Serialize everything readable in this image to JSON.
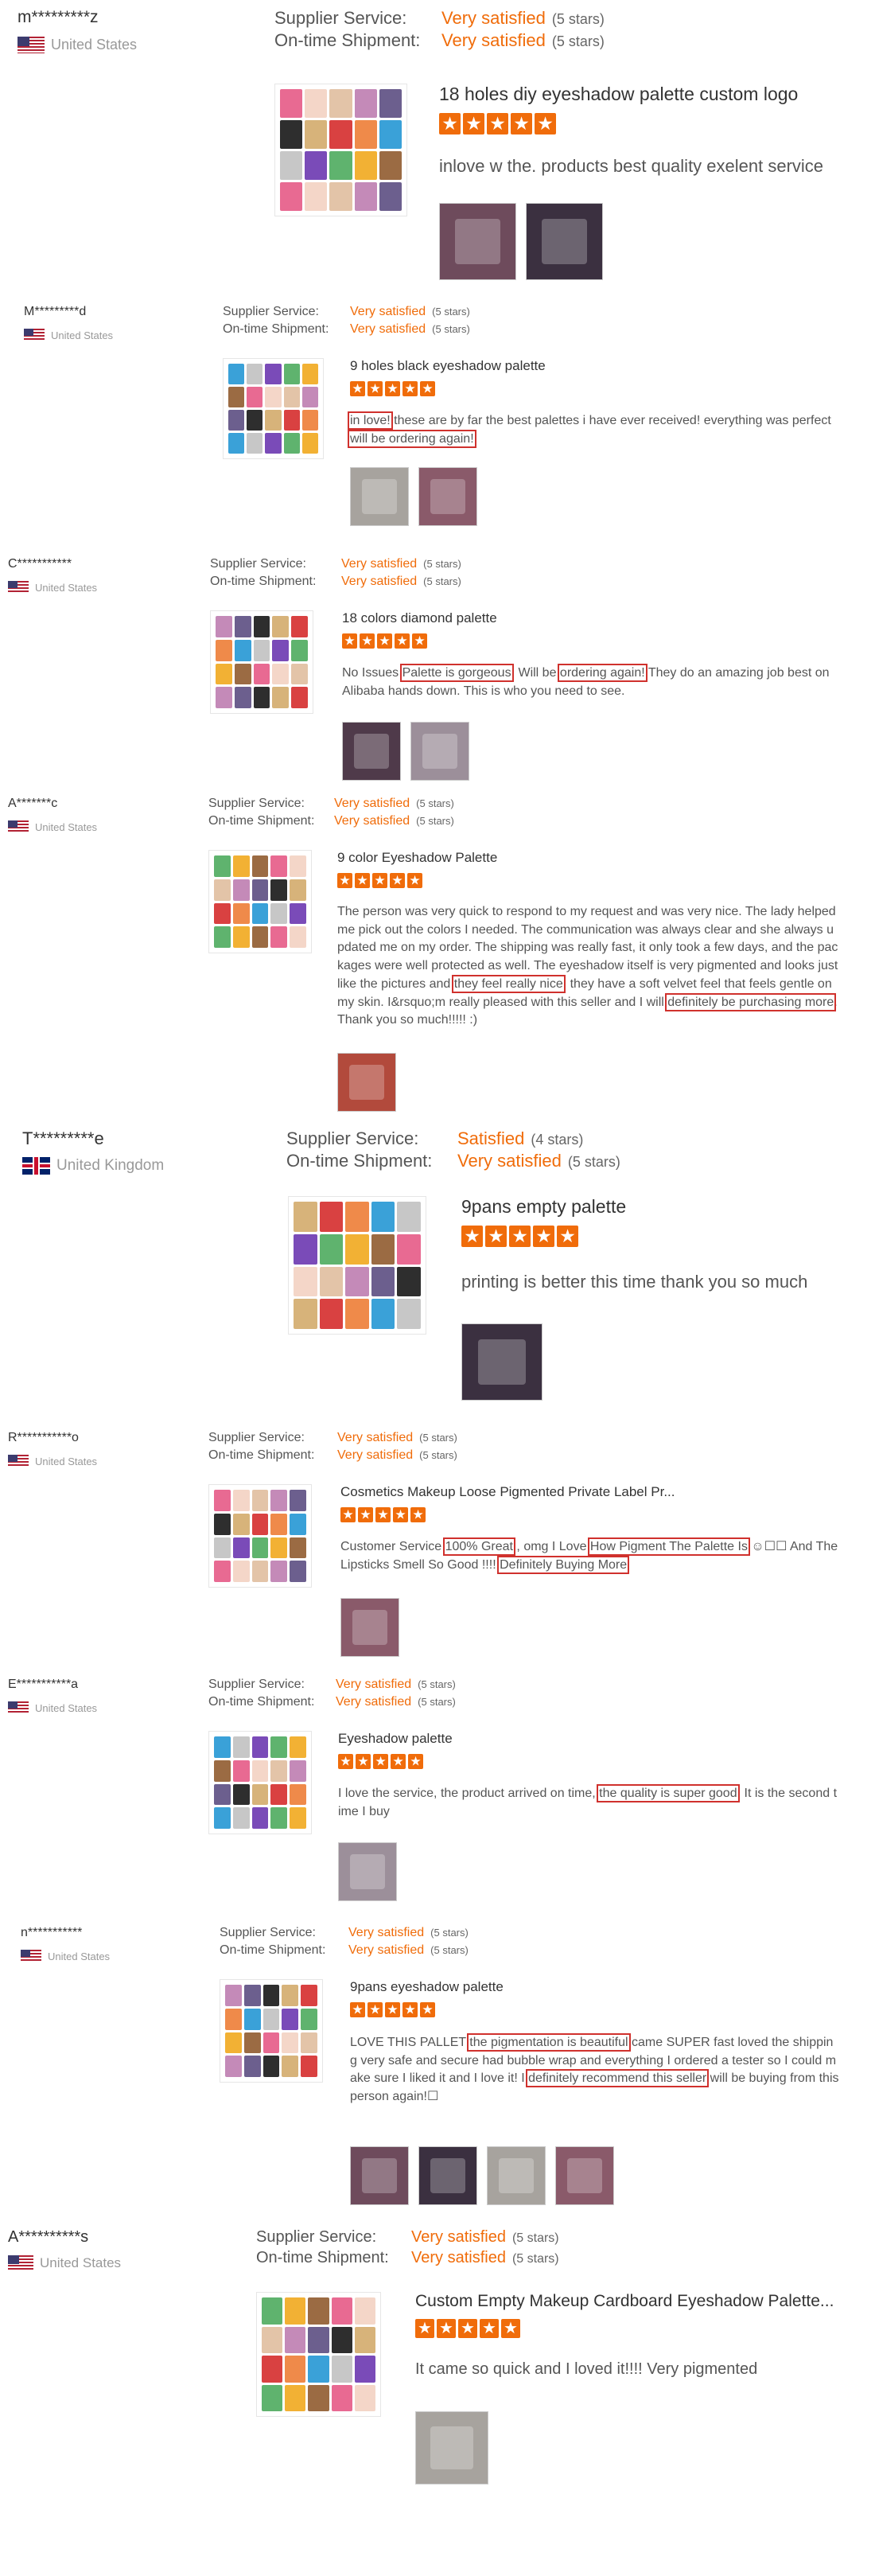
{
  "labels": {
    "supplier_service": "Supplier Service:",
    "shipment": "On-time Shipment:"
  },
  "colors": {
    "accent": "#f06c0a",
    "highlight": "#d0312d"
  },
  "reviews": [
    {
      "user": "m*********z",
      "country": "United States",
      "flag": "us-flag-icon",
      "supplier_value": "Very satisfied",
      "supplier_stars": "(5 stars)",
      "shipment_value": "Very satisfied",
      "shipment_stars": "(5 stars)",
      "product_title": "18 holes diy eyeshadow palette custom logo",
      "rating": 5,
      "text": [
        {
          "t": "inlove w the. products best quality exelent service",
          "hl": false
        }
      ],
      "photo_count": 2
    },
    {
      "user": "M*********d",
      "country": "United States",
      "flag": "us-flag-icon",
      "supplier_value": "Very satisfied",
      "supplier_stars": "(5 stars)",
      "shipment_value": "Very satisfied",
      "shipment_stars": "(5 stars)",
      "product_title": "9 holes black eyeshadow palette",
      "rating": 5,
      "text": [
        {
          "t": "in love!",
          "hl": true
        },
        {
          "t": " these are by far the best palettes i have ever received! everything was perfect ",
          "hl": false
        },
        {
          "t": "will be ordering again!",
          "hl": true
        }
      ],
      "photo_count": 2
    },
    {
      "user": "C***********",
      "country": "United States",
      "flag": "us-flag-icon",
      "supplier_value": "Very satisfied",
      "supplier_stars": "(5 stars)",
      "shipment_value": "Very satisfied",
      "shipment_stars": "(5 stars)",
      "product_title": "18 colors diamond palette",
      "rating": 5,
      "text": [
        {
          "t": "No Issues ",
          "hl": false
        },
        {
          "t": "Palette is gorgeous",
          "hl": true
        },
        {
          "t": "! Will be ",
          "hl": false
        },
        {
          "t": "ordering again!",
          "hl": true
        },
        {
          "t": " They do an amazing job best on Alibaba hands down. This is who you need to see.",
          "hl": false
        }
      ],
      "photo_count": 2
    },
    {
      "user": "A*******c",
      "country": "United States",
      "flag": "us-flag-icon",
      "supplier_value": "Very satisfied",
      "supplier_stars": "(5 stars)",
      "shipment_value": "Very satisfied",
      "shipment_stars": "(5 stars)",
      "product_title": "9 color Eyeshadow Palette",
      "rating": 5,
      "text": [
        {
          "t": "The person was very quick to respond to my request and was very nice. The lady helped me pick out the colors I needed. The communication was always clear and she always updated me on my order. The shipping was really fast, it only took a few days, and the packages were well protected as well. The eyeshadow itself is very pigmented and looks just like the pictures and ",
          "hl": false
        },
        {
          "t": "they feel really nice",
          "hl": true
        },
        {
          "t": ", they have a soft velvet feel that feels gentle on my skin. I&rsquo;m really pleased with this seller and I will ",
          "hl": false
        },
        {
          "t": "definitely be purchasing more",
          "hl": true
        },
        {
          "t": ". Thank you so much!!!!! :)",
          "hl": false
        }
      ],
      "photo_count": 1
    },
    {
      "user": "T*********e",
      "country": "United Kingdom",
      "flag": "uk-flag-icon",
      "supplier_value": "Satisfied",
      "supplier_stars": "(4 stars)",
      "shipment_value": "Very satisfied",
      "shipment_stars": "(5 stars)",
      "product_title": "9pans empty palette",
      "rating": 5,
      "text": [
        {
          "t": "printing is better this time thank you so much",
          "hl": false
        }
      ],
      "photo_count": 1
    },
    {
      "user": "R***********o",
      "country": "United States",
      "flag": "us-flag-icon",
      "supplier_value": "Very satisfied",
      "supplier_stars": "(5 stars)",
      "shipment_value": "Very satisfied",
      "shipment_stars": "(5 stars)",
      "product_title": "Cosmetics Makeup Loose Pigmented Private Label Pr...",
      "rating": 5,
      "text": [
        {
          "t": "Customer Service ",
          "hl": false
        },
        {
          "t": "100% Great",
          "hl": true
        },
        {
          "t": " , omg I Love ",
          "hl": false
        },
        {
          "t": "How Pigment The Palette Is",
          "hl": true
        },
        {
          "t": " ☺☐☐ And The Lipsticks Smell So Good !!!! ",
          "hl": false
        },
        {
          "t": "Definitely Buying More",
          "hl": true
        }
      ],
      "photo_count": 1
    },
    {
      "user": "E***********a",
      "country": "United States",
      "flag": "us-flag-icon",
      "supplier_value": "Very satisfied",
      "supplier_stars": "(5 stars)",
      "shipment_value": "Very satisfied",
      "shipment_stars": "(5 stars)",
      "product_title": "Eyeshadow palette",
      "rating": 5,
      "text": [
        {
          "t": "I love the service, the product arrived on time, ",
          "hl": false
        },
        {
          "t": "the quality is super good",
          "hl": true
        },
        {
          "t": ". It is the second time I buy",
          "hl": false
        }
      ],
      "photo_count": 1
    },
    {
      "user": "n***********",
      "country": "United States",
      "flag": "us-flag-icon",
      "supplier_value": "Very satisfied",
      "supplier_stars": "(5 stars)",
      "shipment_value": "Very satisfied",
      "shipment_stars": "(5 stars)",
      "product_title": "9pans eyeshadow palette",
      "rating": 5,
      "text": [
        {
          "t": "LOVE THIS PALLET ",
          "hl": false
        },
        {
          "t": "the pigmentation is beautiful",
          "hl": true
        },
        {
          "t": " came SUPER fast loved the shipping very safe and secure had bubble wrap and everything I ordered a tester so I could make sure I liked it and I love it! I ",
          "hl": false
        },
        {
          "t": "definitely recommend this seller",
          "hl": true
        },
        {
          "t": " will be buying from this person again!☐",
          "hl": false
        }
      ],
      "photo_count": 4
    },
    {
      "user": "A**********s",
      "country": "United States",
      "flag": "us-flag-icon",
      "supplier_value": "Very satisfied",
      "supplier_stars": "(5 stars)",
      "shipment_value": "Very satisfied",
      "shipment_stars": "(5 stars)",
      "product_title": "Custom Empty Makeup Cardboard Eyeshadow Palette...",
      "rating": 5,
      "text": [
        {
          "t": "It came so quick and I loved it!!!! Very pigmented",
          "hl": false
        }
      ],
      "photo_count": 1
    }
  ]
}
